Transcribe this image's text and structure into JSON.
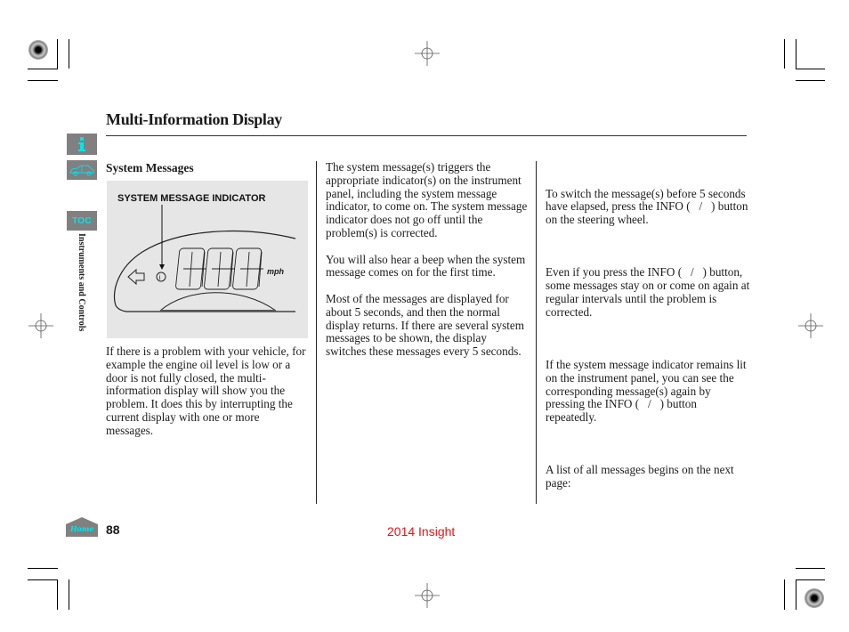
{
  "page": {
    "title": "Multi-Information Display",
    "section_heading": "System Messages",
    "page_number": "88",
    "footer_title": "2014 Insight",
    "side_tab_label": "Instruments and Controls"
  },
  "nav": {
    "info_icon": "info-icon",
    "car_icon": "car-icon",
    "toc_label": "TOC",
    "home_label": "Home",
    "accent_color": "#00e5ee",
    "button_bg": "#808080"
  },
  "figure": {
    "label": "SYSTEM MESSAGE INDICATOR",
    "unit": "mph",
    "digits": "888"
  },
  "columns": {
    "left": [
      "If there is a problem with your vehicle, for example the engine oil level is low or a door is not fully closed, the multi-information display will show you the problem. It does this by interrupting the current display with one or more messages."
    ],
    "middle": [
      "The system message(s) triggers the appropriate indicator(s) on the instrument panel, including the system message indicator, to come on. The system message indicator does not go off until the problem(s) is corrected.",
      "You will also hear a beep when the system message comes on for the first time.",
      "Most of the messages are displayed for about 5 seconds, and then the normal display returns. If there are several system messages to be shown, the display switches these messages every 5 seconds."
    ],
    "right": [
      "To switch the message(s) before 5 seconds have elapsed, press the INFO (   /   ) button on the steering wheel.",
      "Even if you press the INFO (   /   ) button, some messages stay on or come on again at regular intervals until the problem is corrected.",
      "If the system message indicator remains lit on the instrument panel, you can see the corresponding message(s) again by pressing the INFO (   /   ) button repeatedly.",
      "A list of all messages begins on the next page:"
    ]
  }
}
